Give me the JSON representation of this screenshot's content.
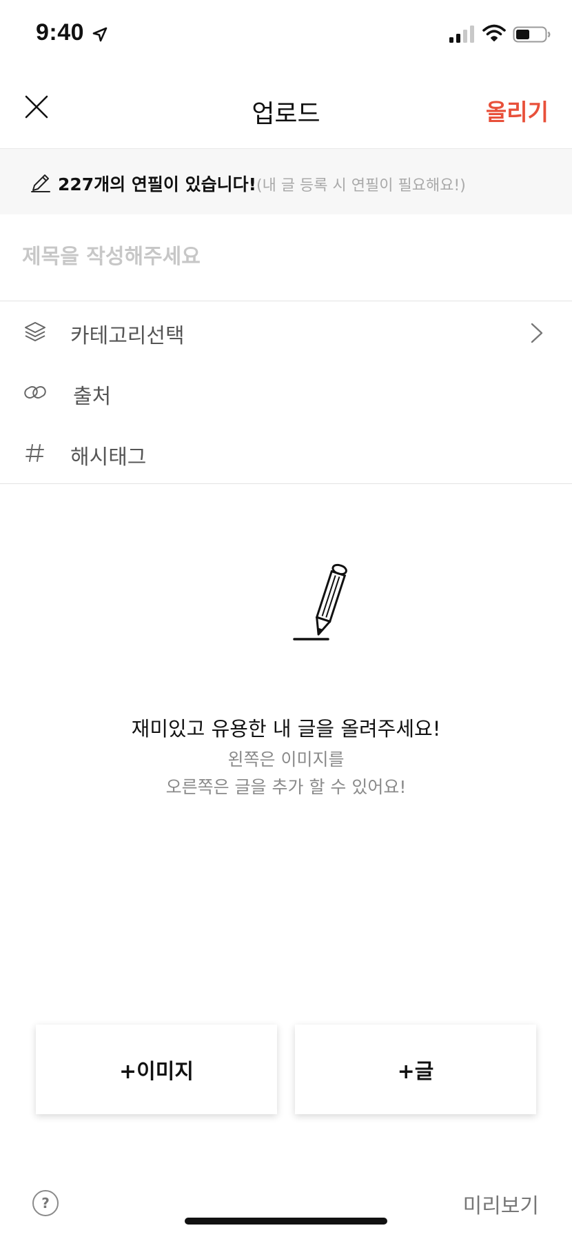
{
  "status_bar": {
    "time": "9:40"
  },
  "nav": {
    "title": "업로드",
    "upload_label": "올리기"
  },
  "banner": {
    "strong_text": "227개의 연필이 있습니다!",
    "sub_text": "(내 글 등록 시 연필이 필요해요!)"
  },
  "title_input": {
    "placeholder": "제목을 작성해주세요",
    "value": ""
  },
  "meta_rows": [
    {
      "label": "카테고리선택",
      "icon": "layers-icon"
    },
    {
      "label": "출처",
      "icon": "link-icon"
    },
    {
      "label": "해시태그",
      "icon": "hashtag-icon"
    }
  ],
  "empty_state": {
    "title": "재미있고 유용한 내 글을 올려주세요!",
    "line1": "왼쪽은 이미지를",
    "line2": "오른쪽은 글을 추가 할 수 있어요!"
  },
  "actions": {
    "add_image": "+이미지",
    "add_text": "+글"
  },
  "footer": {
    "help": "?",
    "preview": "미리보기"
  },
  "colors": {
    "accent": "#e8503a",
    "banner_bg": "#f7f7f7"
  }
}
